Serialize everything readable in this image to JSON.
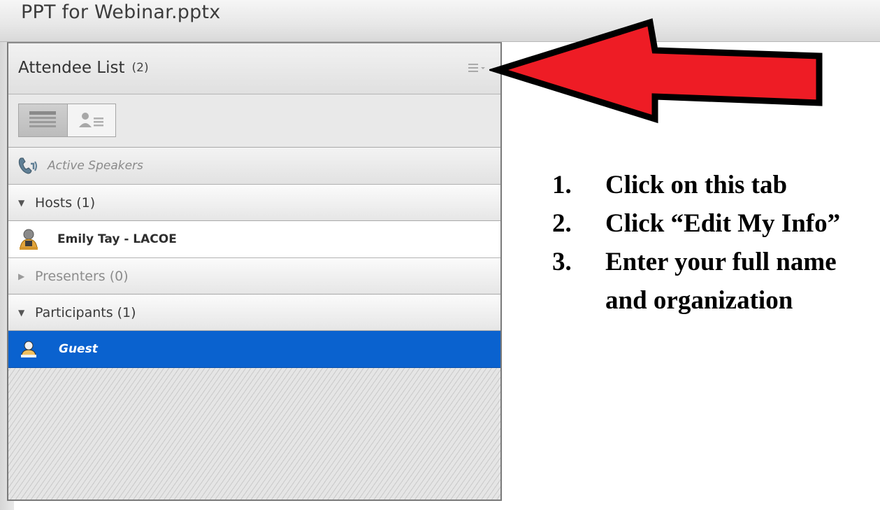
{
  "document": {
    "title": "PPT for Webinar.pptx"
  },
  "pod": {
    "title": "Attendee List",
    "count": "(2)",
    "menu_icon": "list-menu-icon",
    "view_modes": [
      "list-view",
      "attendee-view"
    ],
    "active_speakers_label": "Active Speakers",
    "groups": {
      "hosts": {
        "label": "Hosts (1)",
        "expanded": true
      },
      "presenters": {
        "label": "Presenters (0)",
        "expanded": false
      },
      "participants": {
        "label": "Participants (1)",
        "expanded": true
      }
    },
    "users": {
      "host": {
        "name": "Emily Tay - LACOE"
      },
      "participant": {
        "name": "Guest",
        "selected": true
      }
    }
  },
  "instructions": [
    {
      "number": "1.",
      "text": "Click on this tab"
    },
    {
      "number": "2.",
      "text": "Click “Edit My Info”"
    },
    {
      "number": "3.",
      "text": "Enter your full name",
      "continuation": "and organization"
    }
  ],
  "colors": {
    "selection": "#0a62cf",
    "arrow_fill": "#ee1c25",
    "arrow_outline": "#000000"
  }
}
